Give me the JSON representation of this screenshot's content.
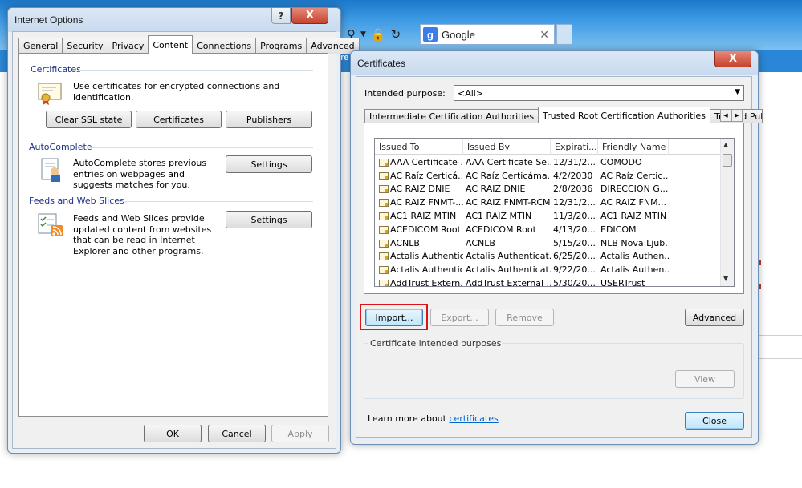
{
  "browser": {
    "edge_text": "re",
    "search_tab_label": "Google",
    "google_logo_letter": "g",
    "close_glyph": "✕"
  },
  "internet_options": {
    "title": "Internet Options",
    "tabs": [
      "General",
      "Security",
      "Privacy",
      "Content",
      "Connections",
      "Programs",
      "Advanced"
    ],
    "active_tab": "Content",
    "certificates": {
      "heading": "Certificates",
      "description": "Use certificates for encrypted connections and identification.",
      "clear_ssl_label": "Clear SSL state",
      "certificates_label": "Certificates",
      "publishers_label": "Publishers"
    },
    "autocomplete": {
      "heading": "AutoComplete",
      "description": "AutoComplete stores previous entries on webpages and suggests matches for you.",
      "settings_label": "Settings"
    },
    "feeds": {
      "heading": "Feeds and Web Slices",
      "description": "Feeds and Web Slices provide updated content from websites that can be read in Internet Explorer and other programs.",
      "settings_label": "Settings"
    },
    "ok_label": "OK",
    "cancel_label": "Cancel",
    "apply_label": "Apply",
    "help_label": "?",
    "close_label": "X"
  },
  "certificates_dialog": {
    "title": "Certificates",
    "intended_purpose_label": "Intended purpose:",
    "intended_purpose_value": "<All>",
    "tabs": [
      "Intermediate Certification Authorities",
      "Trusted Root Certification Authorities",
      "Trusted Pub"
    ],
    "active_tab": "Trusted Root Certification Authorities",
    "columns": [
      "Issued To",
      "Issued By",
      "Expirati...",
      "Friendly Name"
    ],
    "rows": [
      [
        "AAA Certificate ...",
        "AAA Certificate Se...",
        "12/31/2...",
        "COMODO"
      ],
      [
        "AC Raíz Certicá...",
        "AC Raíz Certicáma...",
        "4/2/2030",
        "AC Raíz Certic..."
      ],
      [
        "AC RAIZ DNIE",
        "AC RAIZ DNIE",
        "2/8/2036",
        "DIRECCION G..."
      ],
      [
        "AC RAIZ FNMT-...",
        "AC RAIZ FNMT-RCM",
        "12/31/2...",
        "AC RAIZ FNM..."
      ],
      [
        "AC1 RAIZ MTIN",
        "AC1 RAIZ MTIN",
        "11/3/20...",
        "AC1 RAIZ MTIN"
      ],
      [
        "ACEDICOM Root",
        "ACEDICOM Root",
        "4/13/20...",
        "EDICOM"
      ],
      [
        "ACNLB",
        "ACNLB",
        "5/15/20...",
        "NLB Nova Ljub..."
      ],
      [
        "Actalis Authentic...",
        "Actalis Authenticat...",
        "6/25/20...",
        "Actalis Authen..."
      ],
      [
        "Actalis Authentic...",
        "Actalis Authenticat...",
        "9/22/20...",
        "Actalis Authen..."
      ],
      [
        "AddTrust Extern...",
        "AddTrust External ...",
        "5/30/20...",
        "USERTrust"
      ]
    ],
    "import_label": "Import...",
    "export_label": "Export...",
    "remove_label": "Remove",
    "advanced_label": "Advanced",
    "purposes_label": "Certificate intended purposes",
    "view_label": "View",
    "learn_more_prefix": "Learn more about ",
    "learn_more_link": "certificates",
    "close_button_label": "Close",
    "close_x": "X"
  },
  "colors": {
    "highlight": "#d9141b",
    "link": "#0066cc",
    "browser_blue": "#2a86d6"
  }
}
